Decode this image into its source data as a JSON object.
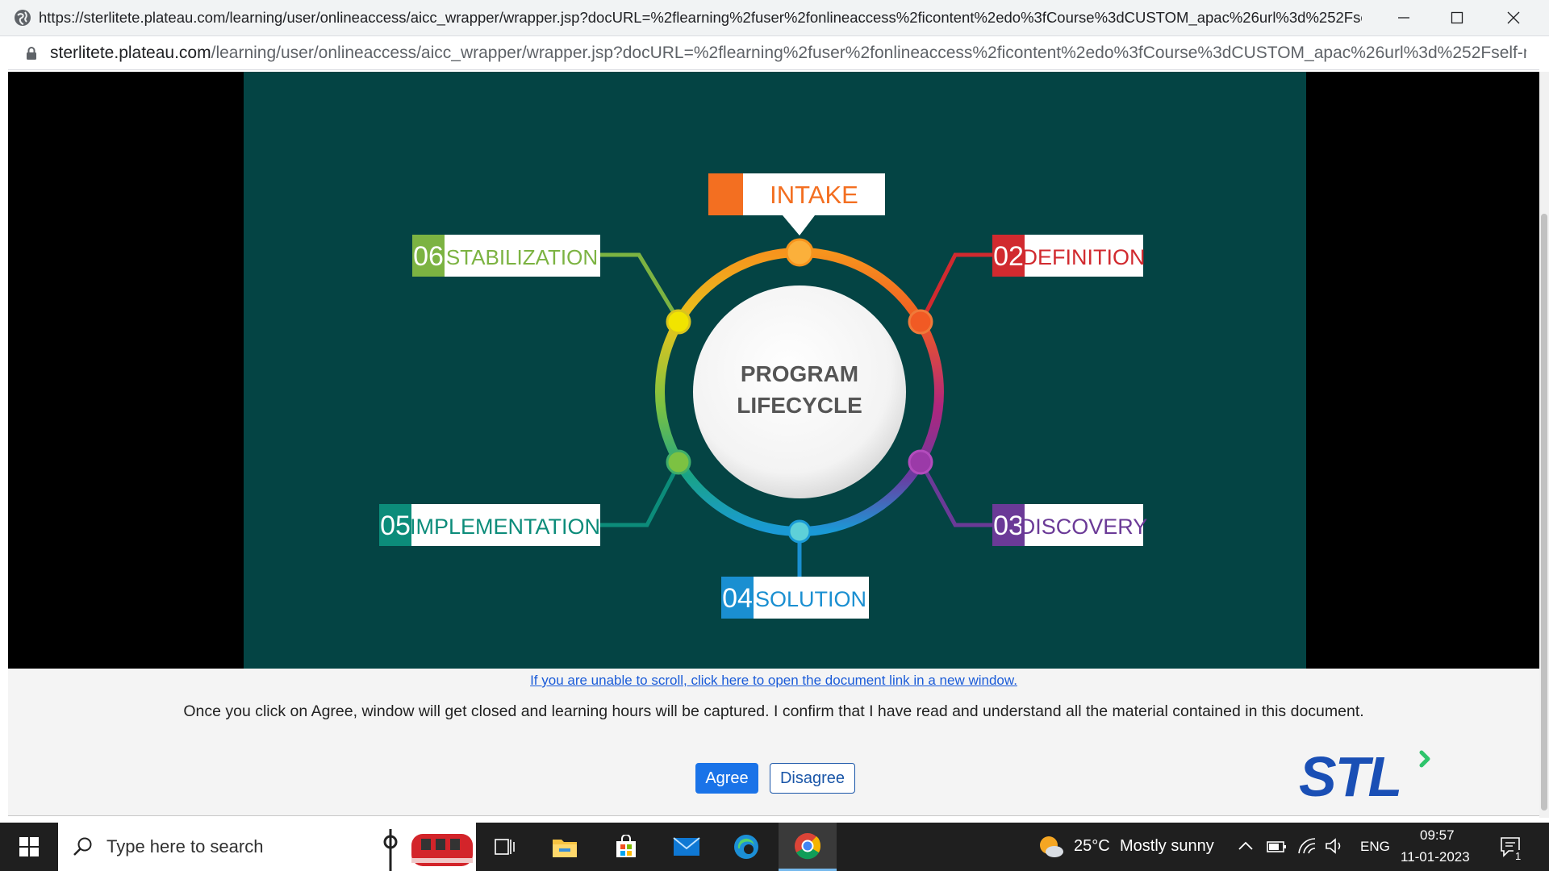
{
  "window": {
    "title": "https://sterlitete.plateau.com/learning/user/onlineaccess/aicc_wrapper/wrapper.jsp?docURL=%2flearning%2fuser%2fonlineaccess%2ficontent%2edo%3fCourse%3dCUSTOM_apac%26url%3d%252Fself-mana...",
    "address_host": "sterlitete.plateau.com",
    "address_path": "/learning/user/onlineaccess/aicc_wrapper/wrapper.jsp?docURL=%2flearning%2fuser%2fonlineaccess%2ficontent%2edo%3fCourse%3dCUSTOM_apac%26url%3d%252Fself-m..."
  },
  "slide": {
    "center_line1": "PROGRAM",
    "center_line2": "LIFECYCLE",
    "stages": [
      {
        "num": "",
        "label": "INTAKE",
        "color": "#f36f21"
      },
      {
        "num": "02",
        "label": "DEFINITION",
        "color": "#d12a2f"
      },
      {
        "num": "03",
        "label": "DISCOVERY",
        "color": "#6b3a97"
      },
      {
        "num": "04",
        "label": "SOLUTION",
        "color": "#1a8fd1"
      },
      {
        "num": "05",
        "label": "IMPLEMENTATION",
        "color": "#0c8c7a"
      },
      {
        "num": "06",
        "label": "STABILIZATION",
        "color": "#7cb342"
      }
    ]
  },
  "footer": {
    "link_text": "If you are unable to scroll, click here to open the document link in a new window.",
    "notice": "Once you click on Agree, window will get closed and learning hours will be captured. I confirm that I have read and understand all the material contained in this document.",
    "agree_label": "Agree",
    "disagree_label": "Disagree",
    "logo_text": "STL"
  },
  "taskbar": {
    "search_placeholder": "Type here to search",
    "weather_temp": "25°C",
    "weather_desc": "Mostly sunny",
    "language": "ENG",
    "time": "09:57",
    "date": "11-01-2023",
    "notification_count": "1"
  }
}
